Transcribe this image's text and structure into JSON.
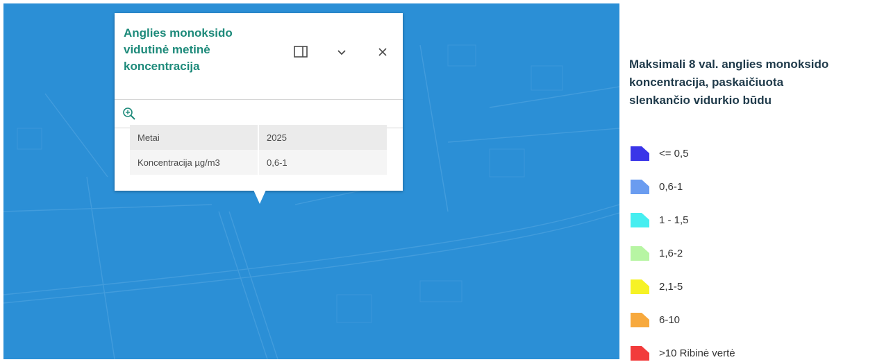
{
  "popup": {
    "title": "Anglies monoksido\nvidutinė metinė\nkoncentracija",
    "icons": [
      "dock-icon",
      "chevron-down-icon",
      "close-icon",
      "zoom-to-icon"
    ],
    "rows": [
      {
        "label": "Metai",
        "value": "2025"
      },
      {
        "label": "Koncentracija µg/m3",
        "value": "0,6-1"
      }
    ]
  },
  "legend": {
    "title": "Maksimali 8 val. anglies monoksido\nkoncentracija, paskaičiuota\nslenkančio vidurkio būdu",
    "items": [
      {
        "label": "<= 0,5",
        "color": "#3a35e8"
      },
      {
        "label": "0,6-1",
        "color": "#6a9cf0"
      },
      {
        "label": "1 - 1,5",
        "color": "#46eef0"
      },
      {
        "label": "1,6-2",
        "color": "#b7f5a3"
      },
      {
        "label": "2,1-5",
        "color": "#f6f225"
      },
      {
        "label": "6-10",
        "color": "#f7a93d"
      },
      {
        "label": ">10 Ribinė  vertė",
        "color": "#f23b3b"
      }
    ]
  },
  "colors": {
    "map_fill": "#2b8fd6",
    "popup_title": "#1d8a7a",
    "legend_title": "#1f3a4a"
  }
}
